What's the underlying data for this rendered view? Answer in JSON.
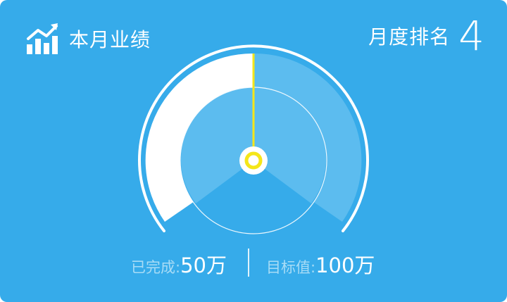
{
  "header": {
    "icon": "trend-chart-icon",
    "title": "本月业绩",
    "rank_label": "月度排名",
    "rank_value": "4"
  },
  "gauge": {
    "progress_fraction": 0.5,
    "colors": {
      "background": "#36abea",
      "completed_fill": "#ffffff",
      "remaining_fill": "#5cbcef",
      "pointer": "#f5e619"
    }
  },
  "footer": {
    "completed_label": "已完成:",
    "completed_value": "50万",
    "target_label": "目标值:",
    "target_value": "100万"
  }
}
